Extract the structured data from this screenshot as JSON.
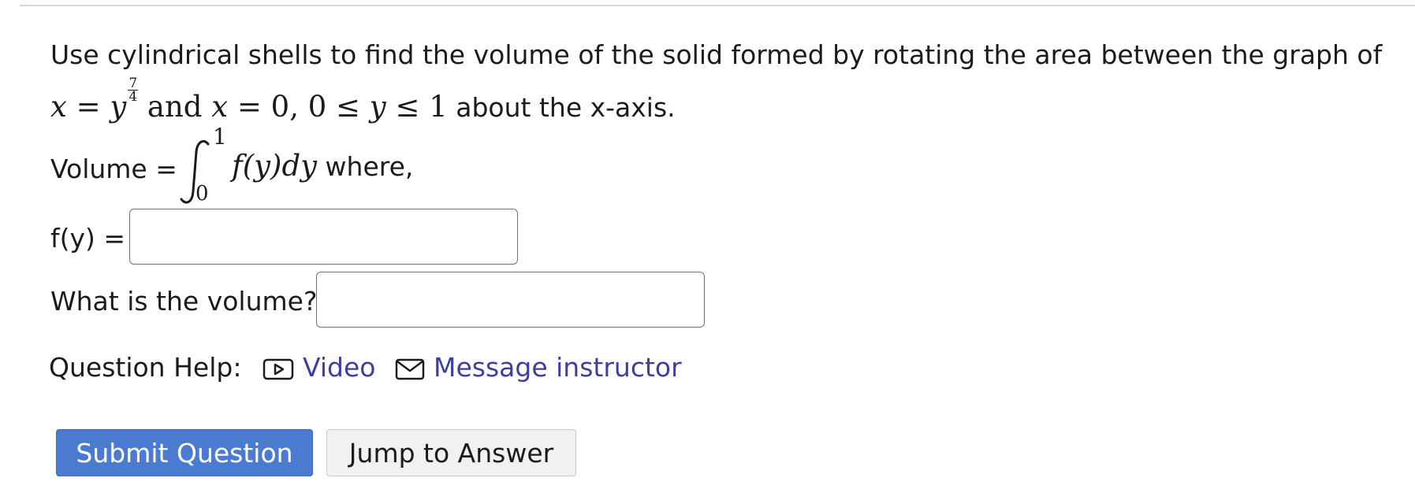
{
  "question": {
    "line1": "Use cylindrical shells to find the volume of the solid formed by rotating the area between the graph of",
    "eq_x1": "x",
    "eq_eq1": " = ",
    "eq_y": "y",
    "exp_num": "7",
    "exp_den": "4",
    "eq_and": " and ",
    "eq_x2": "x",
    "eq_rest": " = 0, 0 ≤ ",
    "eq_y2": "y",
    "eq_le": " ≤ 1",
    "line2_tail": " about the x-axis."
  },
  "volume": {
    "label": "Volume =",
    "upper_limit": "1",
    "lower_limit": "0",
    "integrand": "f(y)dy",
    "where": " where,"
  },
  "fy_field": {
    "label": "f(y) =",
    "value": ""
  },
  "volume_field": {
    "label": "What is the volume?",
    "value": ""
  },
  "help": {
    "label": "Question Help:",
    "video": "Video",
    "message": "Message instructor",
    "video_icon": "video-icon",
    "mail_icon": "mail-icon"
  },
  "buttons": {
    "submit": "Submit Question",
    "jump": "Jump to Answer"
  },
  "colors": {
    "link": "#3e3ea1",
    "submit_bg": "#4a7bd0",
    "jump_bg": "#f1f1f1"
  }
}
